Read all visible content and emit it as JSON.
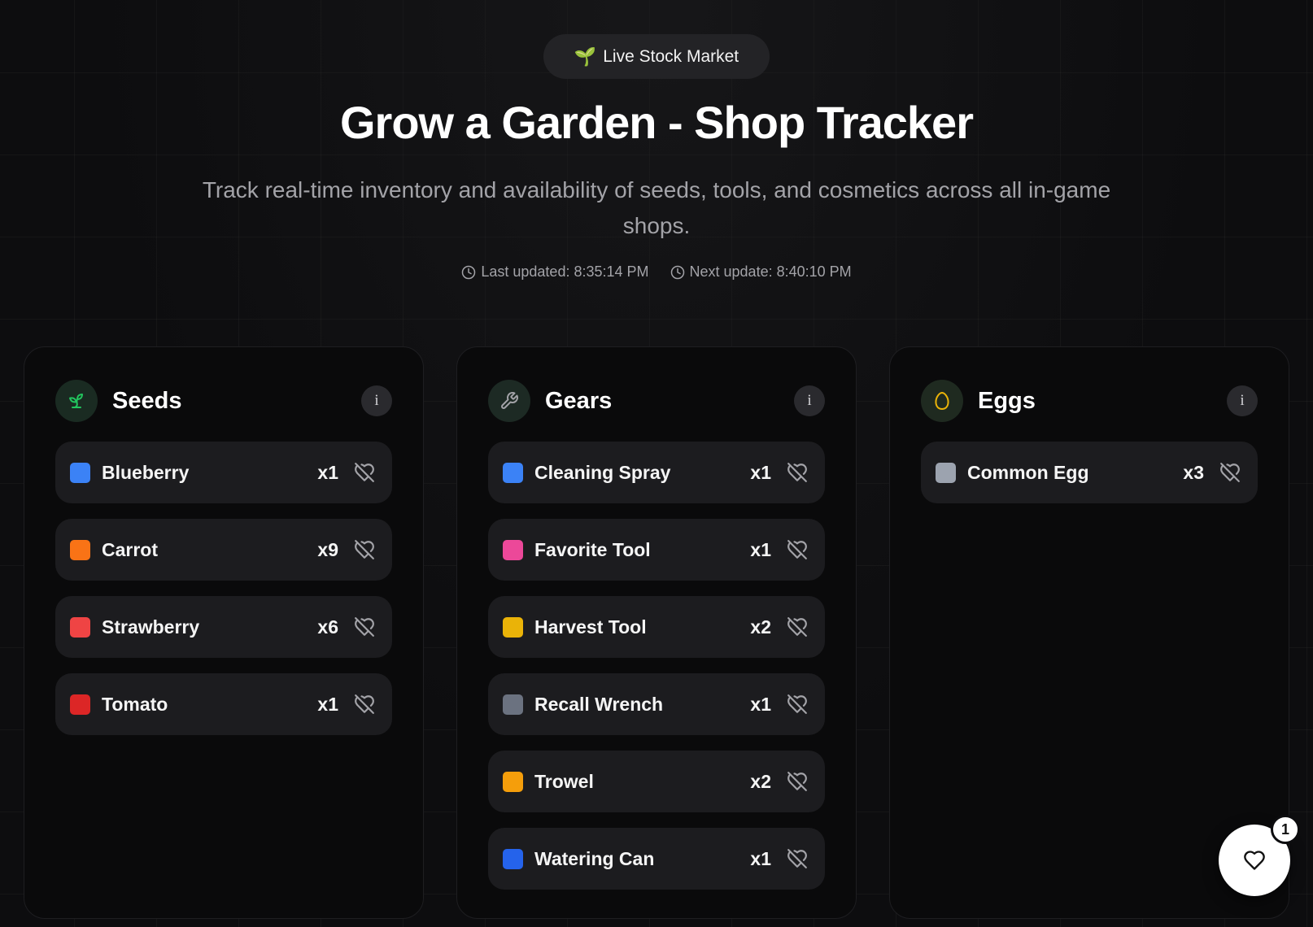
{
  "header": {
    "badge_icon": "sprout-emoji",
    "badge_label": "Live Stock Market",
    "title": "Grow a Garden - Shop Tracker",
    "subtitle": "Track real-time inventory and availability of seeds, tools, and cosmetics across all in-game shops.",
    "last_updated": "Last updated: 8:35:14 PM",
    "next_update": "Next update: 8:40:10 PM"
  },
  "shops": [
    {
      "title": "Seeds",
      "icon": "sprout-icon",
      "icon_color": "#22c55e",
      "info_label": "i",
      "items": [
        {
          "name": "Blueberry",
          "qty": "x1",
          "color": "#3b82f6"
        },
        {
          "name": "Carrot",
          "qty": "x9",
          "color": "#f97316"
        },
        {
          "name": "Strawberry",
          "qty": "x6",
          "color": "#ef4444"
        },
        {
          "name": "Tomato",
          "qty": "x1",
          "color": "#dc2626"
        }
      ]
    },
    {
      "title": "Gears",
      "icon": "wrench-icon",
      "icon_color": "#a3a3a8",
      "info_label": "i",
      "items": [
        {
          "name": "Cleaning Spray",
          "qty": "x1",
          "color": "#3b82f6"
        },
        {
          "name": "Favorite Tool",
          "qty": "x1",
          "color": "#ec4899"
        },
        {
          "name": "Harvest Tool",
          "qty": "x2",
          "color": "#eab308"
        },
        {
          "name": "Recall Wrench",
          "qty": "x1",
          "color": "#6b7280"
        },
        {
          "name": "Trowel",
          "qty": "x2",
          "color": "#f59e0b"
        },
        {
          "name": "Watering Can",
          "qty": "x1",
          "color": "#2563eb"
        }
      ]
    },
    {
      "title": "Eggs",
      "icon": "egg-icon",
      "icon_color": "#eab308",
      "info_label": "i",
      "items": [
        {
          "name": "Common Egg",
          "qty": "x3",
          "color": "#9ca3af"
        }
      ]
    }
  ],
  "favorites_button": {
    "icon": "heart-icon",
    "count": "1"
  },
  "colors": {
    "background": "#0d0d0f",
    "card": "#0a0a0b",
    "row": "#1c1c1f",
    "muted_text": "#a3a3a8"
  }
}
